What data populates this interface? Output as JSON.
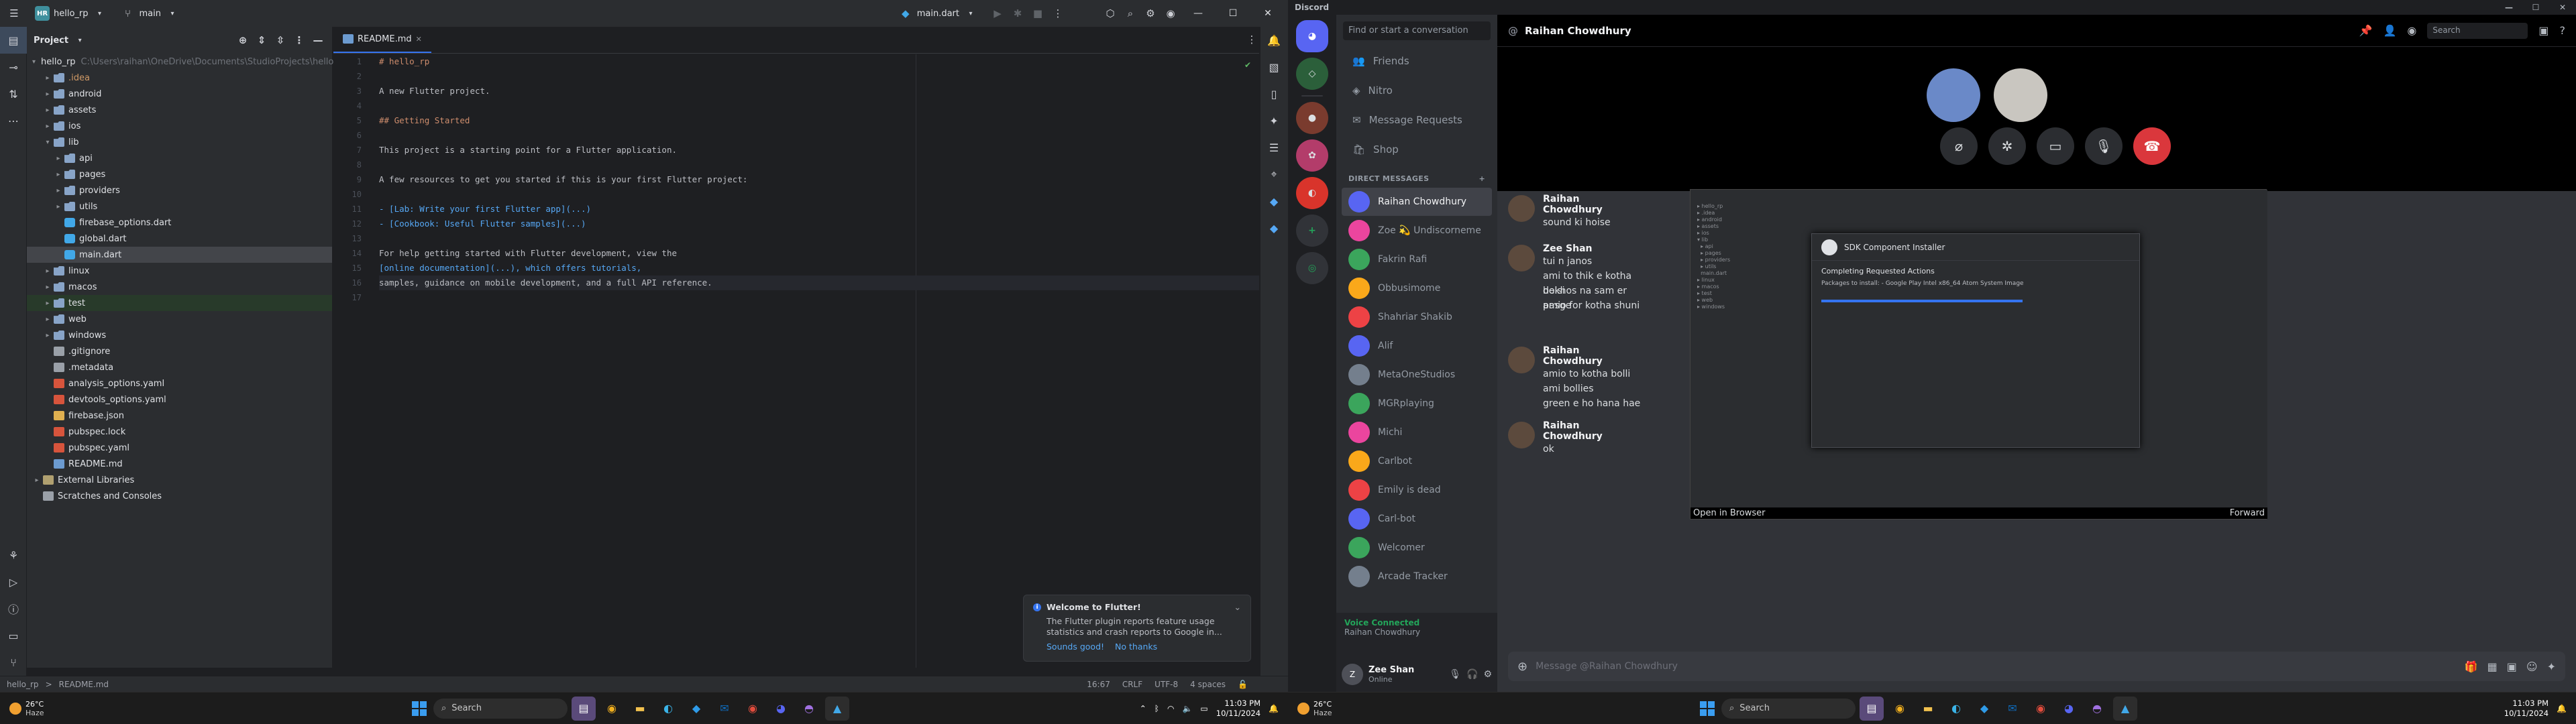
{
  "ide": {
    "project_name": "hello_rp",
    "branch": "main",
    "run_config": "main.dart",
    "panel_title": "Project",
    "tree": [
      {
        "depth": 0,
        "label": "hello_rp",
        "kind": "folder",
        "expanded": true,
        "path": "C:\\Users\\raihan\\OneDrive\\Documents\\StudioProjects\\hello_rp"
      },
      {
        "depth": 1,
        "label": ".idea",
        "kind": "folder",
        "style": "muted"
      },
      {
        "depth": 1,
        "label": "android",
        "kind": "folder"
      },
      {
        "depth": 1,
        "label": "assets",
        "kind": "folder"
      },
      {
        "depth": 1,
        "label": "ios",
        "kind": "folder"
      },
      {
        "depth": 1,
        "label": "lib",
        "kind": "folder",
        "expanded": true
      },
      {
        "depth": 2,
        "label": "api",
        "kind": "folder"
      },
      {
        "depth": 2,
        "label": "pages",
        "kind": "folder"
      },
      {
        "depth": 2,
        "label": "providers",
        "kind": "folder"
      },
      {
        "depth": 2,
        "label": "utils",
        "kind": "folder"
      },
      {
        "depth": 2,
        "label": "firebase_options.dart",
        "kind": "dart"
      },
      {
        "depth": 2,
        "label": "global.dart",
        "kind": "dart"
      },
      {
        "depth": 2,
        "label": "main.dart",
        "kind": "dart",
        "selected": true
      },
      {
        "depth": 1,
        "label": "linux",
        "kind": "folder"
      },
      {
        "depth": 1,
        "label": "macos",
        "kind": "folder"
      },
      {
        "depth": 1,
        "label": "test",
        "kind": "folder",
        "green": true
      },
      {
        "depth": 1,
        "label": "web",
        "kind": "folder"
      },
      {
        "depth": 1,
        "label": "windows",
        "kind": "folder"
      },
      {
        "depth": 1,
        "label": ".gitignore",
        "kind": "file"
      },
      {
        "depth": 1,
        "label": ".metadata",
        "kind": "file"
      },
      {
        "depth": 1,
        "label": "analysis_options.yaml",
        "kind": "yaml"
      },
      {
        "depth": 1,
        "label": "devtools_options.yaml",
        "kind": "yaml"
      },
      {
        "depth": 1,
        "label": "firebase.json",
        "kind": "json"
      },
      {
        "depth": 1,
        "label": "pubspec.lock",
        "kind": "yaml"
      },
      {
        "depth": 1,
        "label": "pubspec.yaml",
        "kind": "yaml"
      },
      {
        "depth": 1,
        "label": "README.md",
        "kind": "md"
      },
      {
        "depth": 0,
        "label": "External Libraries",
        "kind": "lib"
      },
      {
        "depth": 0,
        "label": "Scratches and Consoles",
        "kind": "file"
      }
    ],
    "tab_label": "README.md",
    "code_lines": [
      {
        "n": "1",
        "text": "# hello_rp",
        "type": "h"
      },
      {
        "n": "2",
        "text": "",
        "type": ""
      },
      {
        "n": "3",
        "text": "A new Flutter project.",
        "type": ""
      },
      {
        "n": "4",
        "text": "",
        "type": ""
      },
      {
        "n": "5",
        "text": "## Getting Started",
        "type": "h"
      },
      {
        "n": "6",
        "text": "",
        "type": ""
      },
      {
        "n": "7",
        "text": "This project is a starting point for a Flutter application.",
        "type": ""
      },
      {
        "n": "8",
        "text": "",
        "type": ""
      },
      {
        "n": "9",
        "text": "A few resources to get you started if this is your first Flutter project:",
        "type": ""
      },
      {
        "n": "10",
        "text": "",
        "type": ""
      },
      {
        "n": "11",
        "text": "- [Lab: Write your first Flutter app](...)",
        "type": "link"
      },
      {
        "n": "12",
        "text": "- [Cookbook: Useful Flutter samples](...)",
        "type": "link"
      },
      {
        "n": "13",
        "text": "",
        "type": ""
      },
      {
        "n": "14",
        "text": "For help getting started with Flutter development, view the",
        "type": ""
      },
      {
        "n": "15",
        "text": "[online documentation](...), which offers tutorials,",
        "type": "link2"
      },
      {
        "n": "16",
        "text": "samples, guidance on mobile development, and a full API reference.",
        "type": "cur"
      },
      {
        "n": "17",
        "text": "",
        "type": ""
      }
    ],
    "status": {
      "breadcrumb_project": "hello_rp",
      "breadcrumb_sep": ">",
      "breadcrumb_file": "README.md",
      "position": "16:67",
      "line_sep": "CRLF",
      "encoding": "UTF-8",
      "indent": "4 spaces"
    },
    "notification": {
      "title": "Welcome to Flutter!",
      "body": "The Flutter plugin reports feature usage statistics and crash reports to Google in...",
      "action_primary": "Sounds good!",
      "action_secondary": "No thanks"
    }
  },
  "discord": {
    "app_title": "Discord",
    "search_placeholder": "Find or start a conversation",
    "nav": [
      "Friends",
      "Nitro",
      "Message Requests",
      "Shop"
    ],
    "dm_header": "DIRECT MESSAGES",
    "dm_add": "+",
    "dms": [
      {
        "name": "Raihan Chowdhury",
        "active": true,
        "color": "#5865f2"
      },
      {
        "name": "Zoe 💫 Undiscorneme",
        "color": "#eb459e"
      },
      {
        "name": "Fakrin Rafi",
        "color": "#3ba55c"
      },
      {
        "name": "Obbusimome",
        "color": "#faa81a"
      },
      {
        "name": "Shahriar Shakib",
        "color": "#ed4245"
      },
      {
        "name": "Alif",
        "color": "#5865f2"
      },
      {
        "name": "MetaOneStudios",
        "color": "#747f8d"
      },
      {
        "name": "MGRplaying",
        "color": "#3ba55c"
      },
      {
        "name": "Michi",
        "color": "#eb459e"
      },
      {
        "name": "Carlbot",
        "color": "#faa81a"
      },
      {
        "name": "Emily is dead",
        "color": "#ed4245"
      },
      {
        "name": "Carl-bot",
        "color": "#5865f2"
      },
      {
        "name": "Welcomer",
        "color": "#3ba55c"
      },
      {
        "name": "Arcade Tracker",
        "color": "#747f8d"
      }
    ],
    "voice_status": "Voice Connected",
    "voice_channel": "Raihan Chowdhury",
    "user_name": "Zee Shan",
    "user_status": "Online",
    "channel_title": "Raihan Chowdhury",
    "header_search": "Search",
    "messages": [
      {
        "author": "Raihan Chowdhury",
        "lines": [
          "sound ki hoise"
        ]
      },
      {
        "author": "Zee Shan",
        "lines": [
          "tui n janos",
          "ami to thik e kotha bolsi",
          "dekhos na sam er pasge",
          "amio for kotha shuni"
        ]
      },
      {
        "author": "Raihan Chowdhury",
        "lines": [
          "amio to kotha bolli",
          "ami bollies",
          "green e ho hana hae"
        ]
      },
      {
        "author": "Raihan Chowdhury",
        "lines": [
          "ok"
        ]
      }
    ],
    "viewer_open": "Open in Browser",
    "viewer_forward": "Forward",
    "sdk_title": "SDK Component Installer",
    "sdk_heading": "Completing Requested Actions",
    "sdk_text": "Packages to install: - Google Play Intel x86_64 Atom System Image",
    "composer_placeholder": "Message @Raihan Chowdhury"
  },
  "taskbar_left": {
    "temp": "26°C",
    "cond": "Haze",
    "search": "Search",
    "time": "11:03 PM",
    "date": "10/11/2024"
  },
  "taskbar_right": {
    "temp": "26°C",
    "cond": "Haze",
    "search": "Search",
    "time": "11:03 PM",
    "date": "10/11/2024"
  }
}
